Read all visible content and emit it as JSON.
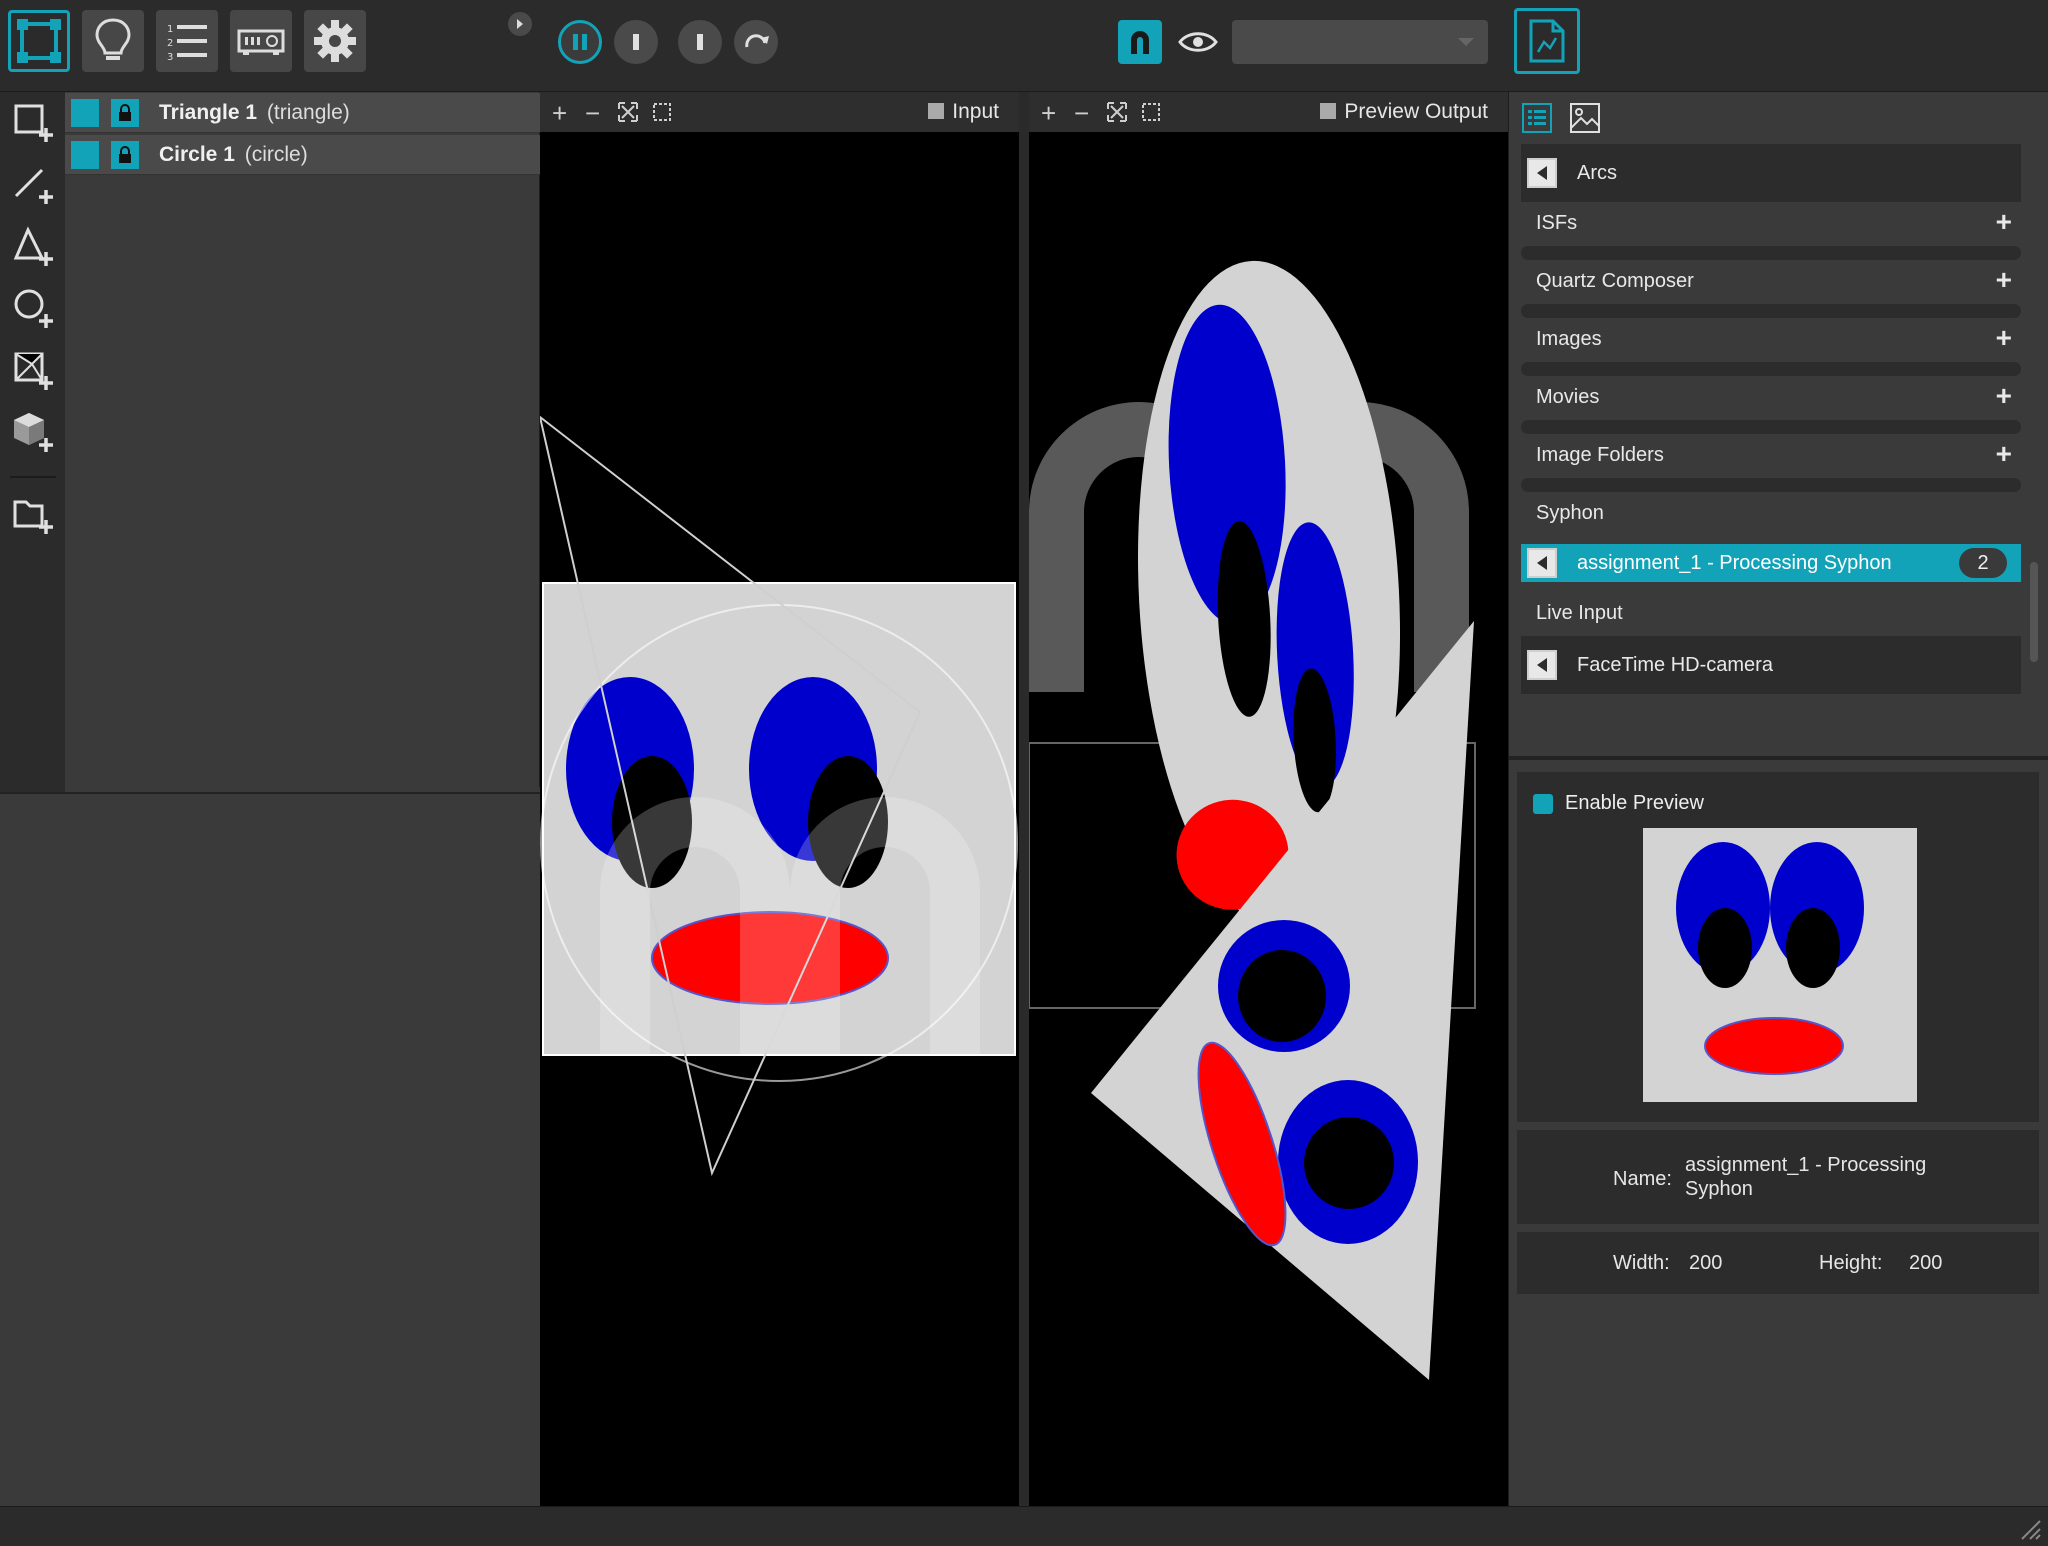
{
  "toolbar": {
    "mode_buttons": [
      "mapping-mode-icon",
      "idea-icon",
      "numbered-list-icon",
      "projector-icon",
      "gear-icon"
    ],
    "playback_buttons": [
      "pause-icon",
      "stop-icon",
      "play-icon",
      "rewind-icon"
    ],
    "preview_select_value": "",
    "accent": "#13a3b8"
  },
  "tools": [
    "add-quad-icon",
    "add-line-icon",
    "add-triangle-icon",
    "add-circle-icon",
    "add-mesh-icon",
    "add-cube-icon",
    "import-folder-icon"
  ],
  "layers": [
    {
      "name": "Triangle 1",
      "type": "(triangle)"
    },
    {
      "name": "Circle 1",
      "type": "(circle)"
    }
  ],
  "panes": {
    "input": {
      "title": "Input"
    },
    "output": {
      "title": "Preview Output"
    }
  },
  "sources": {
    "top_item": "Arcs",
    "categories": [
      {
        "label": "ISFs",
        "plus": "+"
      },
      {
        "label": "Quartz Composer",
        "plus": "+"
      },
      {
        "label": "Images",
        "plus": "+"
      },
      {
        "label": "Movies",
        "plus": "+"
      },
      {
        "label": "Image Folders",
        "plus": "+"
      }
    ],
    "syphon_label": "Syphon",
    "syphon_item": "assignment_1 - Processing Syphon",
    "syphon_badge": "2",
    "live_input_label": "Live Input",
    "live_item": "FaceTime HD-camera"
  },
  "preview": {
    "enable_label": "Enable Preview",
    "name_label": "Name:",
    "name_value_line1": "assignment_1 - Processing",
    "name_value_line2": "Syphon",
    "width_label": "Width:",
    "width_value": "200",
    "height_label": "Height:",
    "height_value": "200"
  }
}
